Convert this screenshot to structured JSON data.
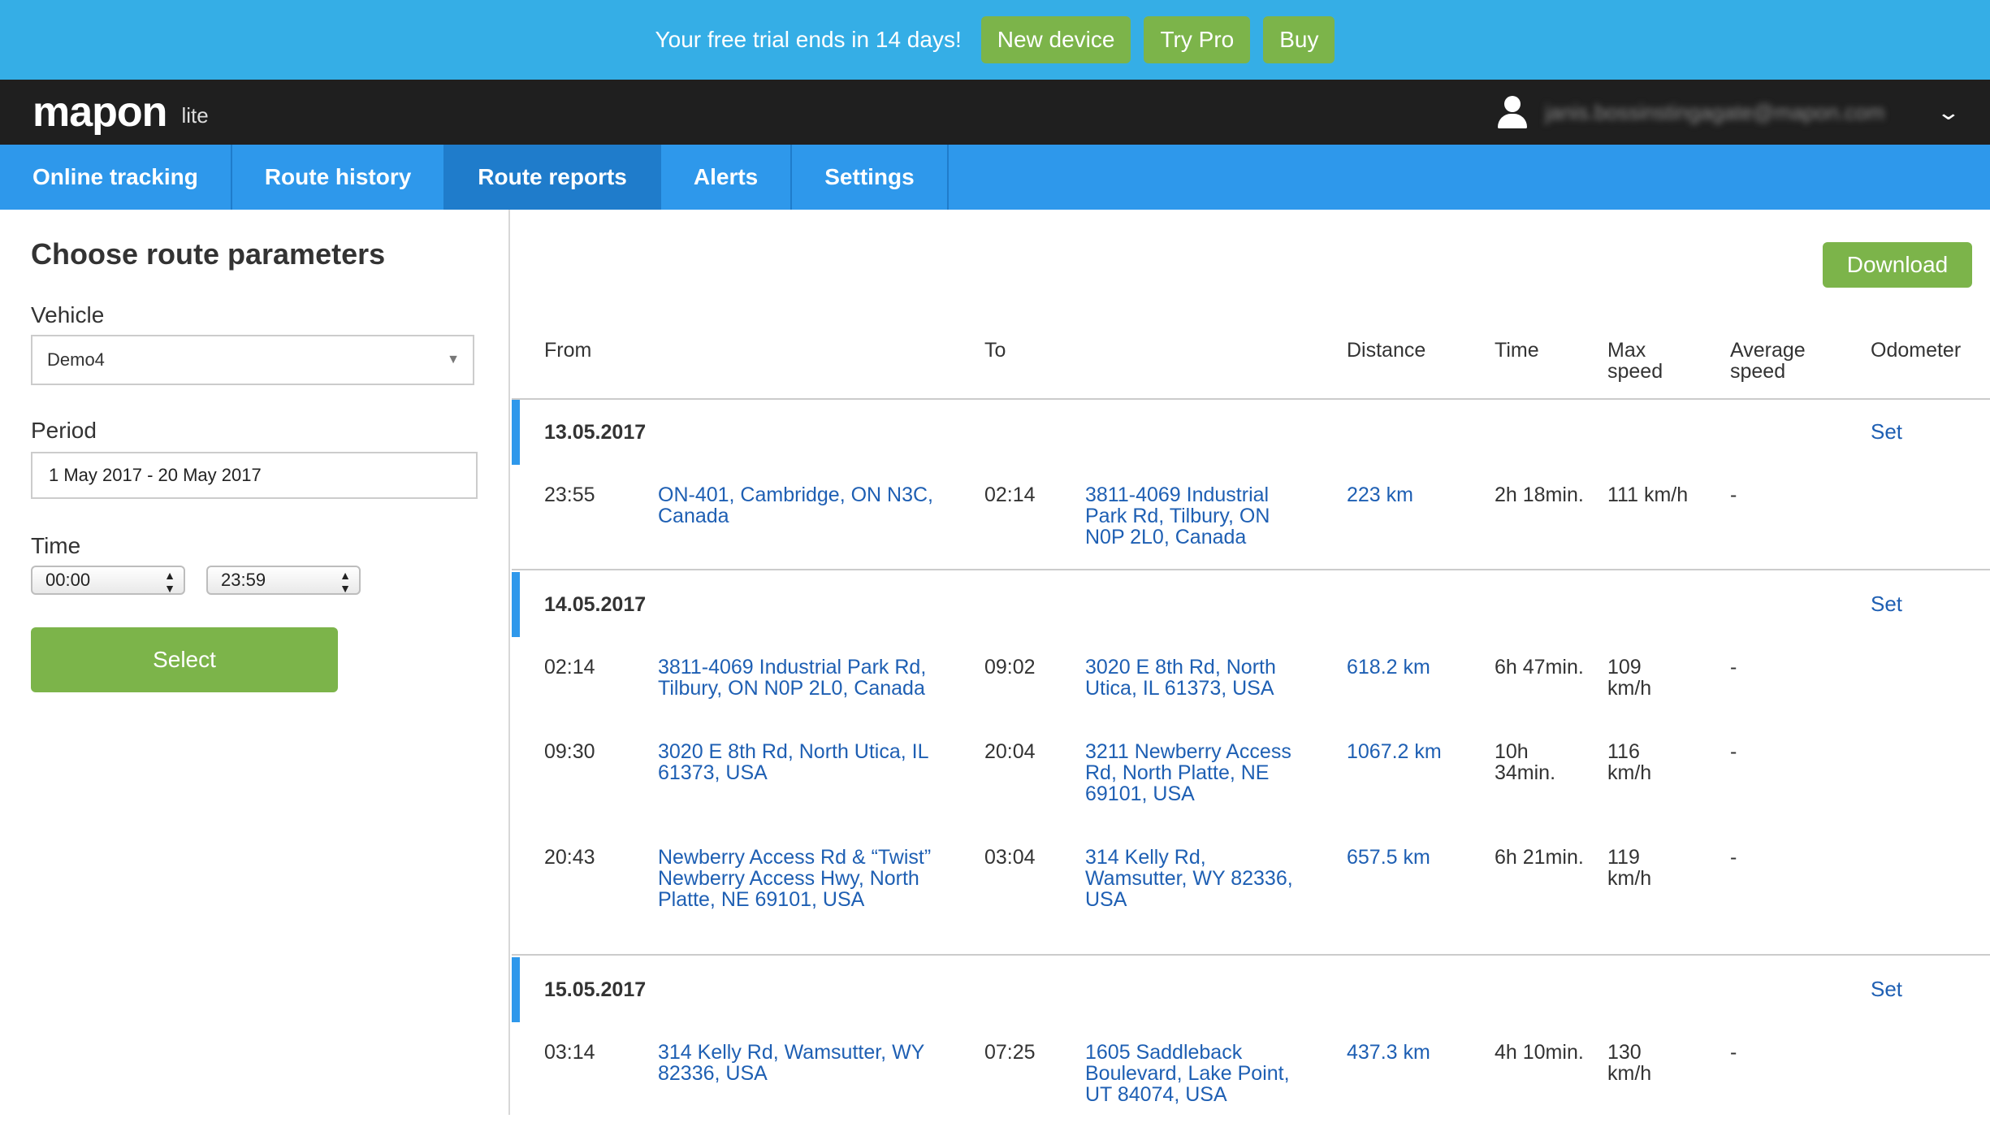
{
  "banner": {
    "text": "Your free trial ends in 14 days!",
    "buttons": [
      "New device",
      "Try Pro",
      "Buy"
    ]
  },
  "header": {
    "logo": "mapon",
    "logo_sub": "lite",
    "user_email": "janis.bossinstingagate@mapon.com"
  },
  "nav": {
    "tabs": [
      "Online tracking",
      "Route history",
      "Route reports",
      "Alerts",
      "Settings"
    ],
    "active": "Route reports"
  },
  "sidebar": {
    "title": "Choose route parameters",
    "vehicle_label": "Vehicle",
    "vehicle_value": "Demo4",
    "period_label": "Period",
    "period_value": "1 May 2017 - 20 May 2017",
    "time_label": "Time",
    "time_from": "00:00",
    "time_to": "23:59",
    "select_label": "Select"
  },
  "report": {
    "download_label": "Download",
    "columns": [
      "From",
      "To",
      "Distance",
      "Time",
      "Max speed",
      "Average speed",
      "Odometer"
    ],
    "set_label": "Set",
    "groups": [
      {
        "date": "13.05.2017",
        "rows": [
          {
            "start": "23:55",
            "from": "ON-401, Cambridge, ON N3C, Canada",
            "end": "02:14",
            "to": "3811-4069 Industrial Park Rd, Tilbury, ON N0P 2L0, Canada",
            "distance": "223 km",
            "duration": "2h 18min.",
            "max_speed": "111 km/h",
            "avg_speed": "-"
          }
        ]
      },
      {
        "date": "14.05.2017",
        "rows": [
          {
            "start": "02:14",
            "from": "3811-4069 Industrial Park Rd, Tilbury, ON N0P 2L0, Canada",
            "end": "09:02",
            "to": "3020 E 8th Rd, North Utica, IL 61373, USA",
            "distance": "618.2 km",
            "duration": "6h 47min.",
            "max_speed": "109 km/h",
            "avg_speed": "-"
          },
          {
            "start": "09:30",
            "from": "3020 E 8th Rd, North Utica, IL 61373, USA",
            "end": "20:04",
            "to": "3211 Newberry Access Rd, North Platte, NE 69101, USA",
            "distance": "1067.2 km",
            "duration": "10h 34min.",
            "max_speed": "116 km/h",
            "avg_speed": "-"
          },
          {
            "start": "20:43",
            "from": "Newberry Access Rd & “Twist” Newberry Access Hwy, North Platte, NE 69101, USA",
            "end": "03:04",
            "to": "314 Kelly Rd, Wamsutter, WY 82336, USA",
            "distance": "657.5 km",
            "duration": "6h 21min.",
            "max_speed": "119 km/h",
            "avg_speed": "-"
          }
        ]
      },
      {
        "date": "15.05.2017",
        "rows": [
          {
            "start": "03:14",
            "from": "314 Kelly Rd, Wamsutter, WY 82336, USA",
            "end": "07:25",
            "to": "1605 Saddleback Boulevard, Lake Point, UT 84074, USA",
            "distance": "437.3 km",
            "duration": "4h 10min.",
            "max_speed": "130 km/h",
            "avg_speed": "-"
          }
        ]
      }
    ]
  },
  "colors": {
    "banner": "#35aee6",
    "nav": "#2e98eb",
    "nav_active": "#1f7ccb",
    "green": "#7cb44a",
    "link": "#1e5fb3",
    "header": "#1f1f1f"
  }
}
